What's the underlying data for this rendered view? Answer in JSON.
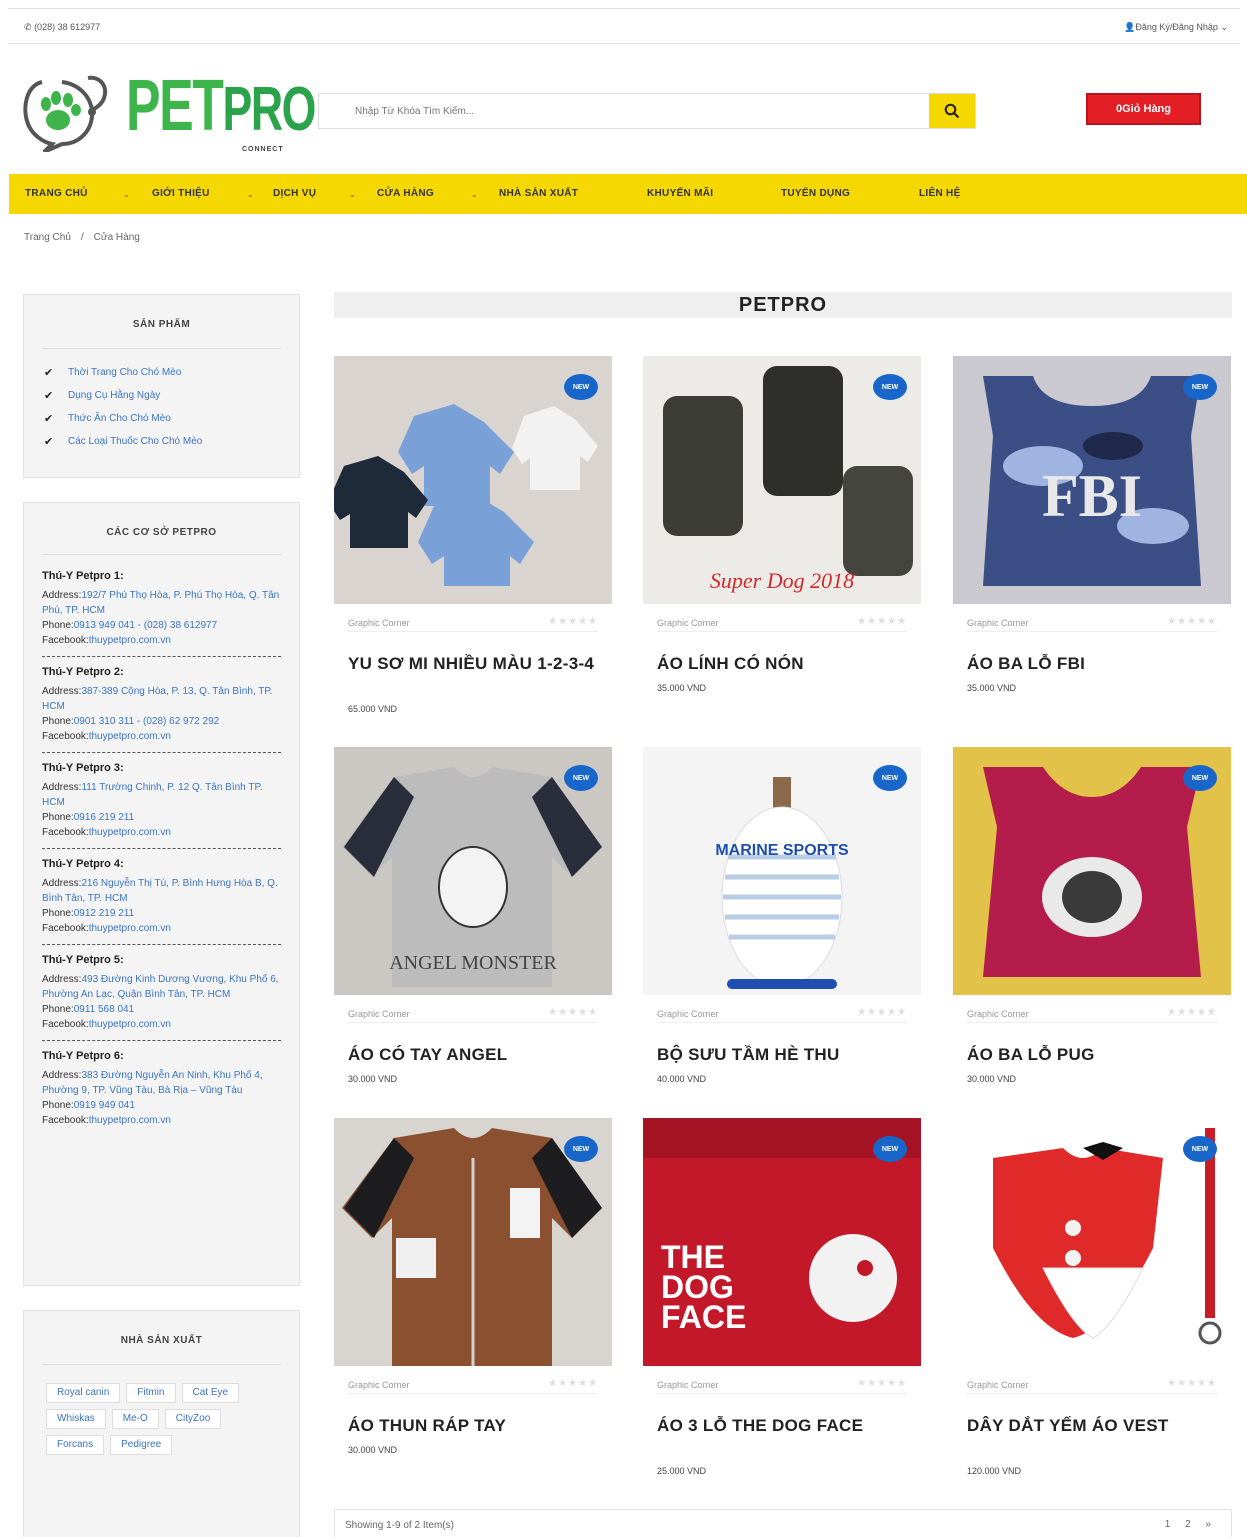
{
  "topbar": {
    "phone": "(028) 38 612977",
    "account": "Đăng Ký/Đăng Nhập"
  },
  "logo": {
    "pet": "PET",
    "pro": "PRO",
    "connect": "CONNECT"
  },
  "search": {
    "placeholder": "Nhập Từ Khóa Tìm Kiếm..."
  },
  "cart": {
    "count": "0",
    "label": "Giỏ Hàng"
  },
  "nav": {
    "items": [
      "TRANG CHỦ",
      "GIỚI THIỆU",
      "DỊCH VỤ",
      "CỬA HÀNG",
      "NHÀ SẢN XUẤT",
      "KHUYẾN MÃI",
      "TUYỂN DỤNG",
      "LIÊN HỆ"
    ]
  },
  "breadcrumb": {
    "home": "Trang Chủ",
    "sep": "/",
    "current": "Cửa Hàng"
  },
  "sidebar": {
    "products_title": "SẢN PHẨM",
    "categories": [
      "Thời Trang Cho Chó Mèo",
      "Dụng Cụ Hằng Ngày",
      "Thức Ăn Cho Chó Mèo",
      "Các Loại Thuốc Cho Chó Mèo"
    ],
    "branches_title": "CÁC CƠ SỞ PETPRO",
    "address_label": "Address:",
    "phone_label": "Phone:",
    "facebook_label": "Facebook:",
    "branches": [
      {
        "name": "Thú-Y Petpro 1:",
        "address": "192/7 Phú Thọ Hòa, P. Phú Thọ Hòa, Q. Tân Phú, TP. HCM",
        "phone": "0913 949 041 - (028) 38 612977",
        "facebook": "thuypetpro.com.vn"
      },
      {
        "name": "Thú-Y Petpro 2:",
        "address": "387-389 Cộng Hòa, P. 13, Q. Tân Bình, TP. HCM",
        "phone": "0901 310 311 - (028) 62 972 292",
        "facebook": "thuypetpro.com.vn"
      },
      {
        "name": "Thú-Y Petpro 3:",
        "address": "111 Trường Chinh, P. 12 Q. Tân Bình TP. HCM",
        "phone": "0916 219 211",
        "facebook": "thuypetpro.com.vn"
      },
      {
        "name": "Thú-Y Petpro 4:",
        "address": "216 Nguyễn Thị Tú, P. Bình Hưng Hòa B, Q. Bình Tân, TP. HCM",
        "phone": "0912 219 211",
        "facebook": "thuypetpro.com.vn"
      },
      {
        "name": "Thú-Y Petpro 5:",
        "address": "493 Đường Kinh Dương Vương, Khu Phố 6, Phường An Lạc, Quận Bình Tân, TP. HCM",
        "phone": "0911 568 041",
        "facebook": "thuypetpro.com.vn"
      },
      {
        "name": "Thú-Y Petpro 6:",
        "address": "383 Đường Nguyễn An Ninh, Khu Phố 4, Phường 9, TP. Vũng Tàu, Bà Rịa – Vũng Tàu",
        "phone": "0919 949 041",
        "facebook": "thuypetpro.com.vn"
      }
    ],
    "brands_title": "NHÀ SẢN XUẤT",
    "brands": [
      "Royal canin",
      "Fitmin",
      "Cat Eye",
      "Whiskas",
      "Me-O",
      "CityZoo",
      "Forcans",
      "Pedigree"
    ]
  },
  "main": {
    "title": "PETPRO"
  },
  "products": [
    {
      "category": "Graphic Corner",
      "name": "YU SƠ MI NHIỀU MÀU 1-2-3-4",
      "price": "65.000 VND",
      "badge": "NEW"
    },
    {
      "category": "Graphic Corner",
      "name": "ÁO LÍNH CÓ NÓN",
      "price": "35.000 VND",
      "badge": "NEW"
    },
    {
      "category": "Graphic Corner",
      "name": "ÁO BA LỖ FBI",
      "price": "35.000 VND",
      "badge": "NEW"
    },
    {
      "category": "Graphic Corner",
      "name": "ÁO CÓ TAY ANGEL",
      "price": "30.000 VND",
      "badge": "NEW"
    },
    {
      "category": "Graphic Corner",
      "name": "BỘ SƯU TẦM HÈ THU",
      "price": "40.000 VND",
      "badge": "NEW"
    },
    {
      "category": "Graphic Corner",
      "name": "ÁO BA LỖ PUG",
      "price": "30.000 VND",
      "badge": "NEW"
    },
    {
      "category": "Graphic Corner",
      "name": "ÁO THUN RÁP TAY",
      "price": "30.000 VND",
      "badge": "NEW"
    },
    {
      "category": "Graphic Corner",
      "name": "ÁO 3 LỖ THE DOG FACE",
      "price": "25.000 VND",
      "badge": "NEW"
    },
    {
      "category": "Graphic Corner",
      "name": "DÂY DẮT YẾM ÁO VEST",
      "price": "120.000 VND",
      "badge": "NEW"
    }
  ],
  "product_images": {
    "img3_text": "FBI",
    "img5_text": "MARINE SPORTS",
    "img8_line1": "THE",
    "img8_line2": "DOG",
    "img8_line3": "FACE",
    "img2_caption": "Super Dog 2018",
    "img4_text": "ANGEL MONSTER"
  },
  "pager": {
    "showing": "Showing 1-9 of 2 Item(s)",
    "pages": "1 2 »"
  },
  "colors": {
    "accent_yellow": "#f5d800",
    "cart_red": "#e31e24",
    "link_blue": "#3b74c6",
    "badge_blue": "#1866c9",
    "logo_green": "#3db54a"
  }
}
